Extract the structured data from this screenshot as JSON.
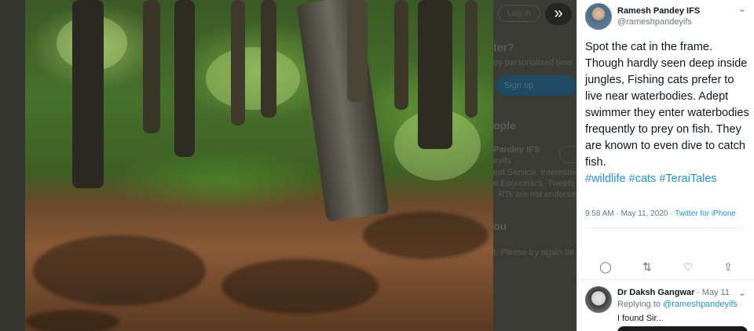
{
  "background_page": {
    "login_label": "Log in",
    "prompt_heading": "ter?",
    "prompt_sub": "oy personalized time",
    "signup_label": "Sign up",
    "people_heading": "ople",
    "person_name": "Pandey IFS",
    "person_handle": "eyifs",
    "person_bio_1": "est Service. Interested",
    "person_bio_2": "e Economics. Tweets a",
    "person_bio_3": ". RTs are not endorsem",
    "you_heading": "ou",
    "you_sub": "t. Please try again lat"
  },
  "viewer": {
    "expand_icon": "double-chevron-right-icon",
    "expand_glyph": "»"
  },
  "tweet": {
    "author_name": "Ramesh Pandey IFS",
    "author_handle": "@rameshpandeyifs",
    "menu_glyph": "⌄",
    "text": "Spot the cat in the frame. Though hardly seen deep inside jungles, Fishing cats prefer to live near waterbodies. Adept swimmer they enter waterbodies frequently to prey on fish. They are known to even dive to catch fish.",
    "hashtags": [
      "#wildlife",
      "#cats",
      "#TeraiTales"
    ],
    "timestamp": "9:58 AM · May 11, 2020 · ",
    "source": "Twitter for iPhone",
    "actions": {
      "reply_glyph": "◯",
      "retweet_glyph": "⇅",
      "like_glyph": "♡",
      "share_glyph": "⇪"
    }
  },
  "reply": {
    "name": "Dr Daksh Gangwar",
    "time": "· May 11",
    "menu_glyph": "⌄",
    "replying_to_label": "Replying to ",
    "replying_to_handle": "@rameshpandeyifs",
    "text": "I found Sir..."
  },
  "colors": {
    "link": "#1b95e0",
    "text": "#14171a",
    "muted": "#657786"
  }
}
